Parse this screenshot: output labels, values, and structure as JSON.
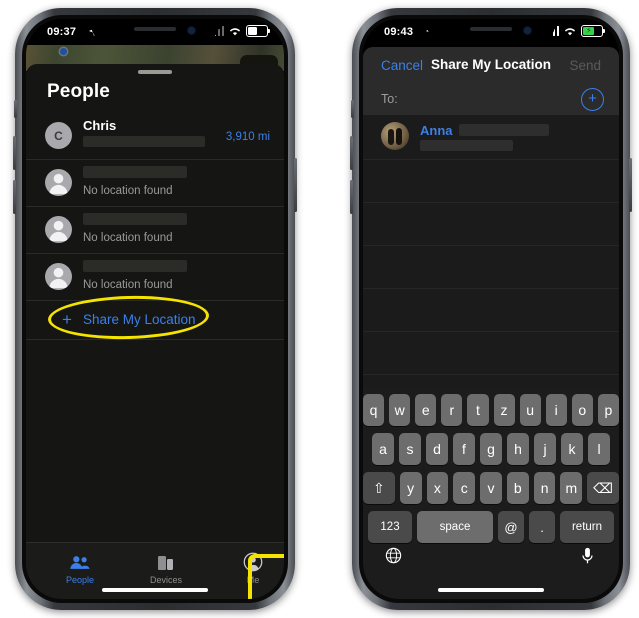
{
  "left_phone": {
    "status_bar": {
      "time": "09:37",
      "location_arrow_icon": "location-arrow-icon",
      "cellular_icon": "cellular-bars-icon",
      "wifi_icon": "wifi-icon",
      "battery_icon": "battery-icon",
      "battery_state": "normal"
    },
    "sheet_title": "People",
    "people": [
      {
        "avatar_initial": "C",
        "avatar_type": "initial",
        "name": "Chris",
        "subtitle": "",
        "distance": "3,910 mi",
        "redacted_address": true
      },
      {
        "avatar_initial": "",
        "avatar_type": "placeholder",
        "name": "",
        "subtitle": "No location found",
        "distance": "",
        "redacted_name": true
      },
      {
        "avatar_initial": "",
        "avatar_type": "placeholder",
        "name": "",
        "subtitle": "No location found",
        "distance": "",
        "redacted_name": true
      },
      {
        "avatar_initial": "",
        "avatar_type": "placeholder",
        "name": "",
        "subtitle": "No location found",
        "distance": "",
        "redacted_name": true
      }
    ],
    "share_row": {
      "plus": "+",
      "label": "Share My Location"
    },
    "tab_bar": [
      {
        "label": "People",
        "icon": "people-icon",
        "selected": true
      },
      {
        "label": "Devices",
        "icon": "devices-icon",
        "selected": false
      },
      {
        "label": "Me",
        "icon": "person-circle-icon",
        "selected": false
      }
    ],
    "highlights": {
      "share_ellipse": "yellow-ellipse-annotation",
      "me_box": "yellow-box-annotation"
    }
  },
  "right_phone": {
    "status_bar": {
      "time": "09:43",
      "location_arrow_icon": "location-arrow-icon",
      "cellular_icon": "cellular-bars-icon",
      "wifi_icon": "wifi-icon",
      "battery_icon": "battery-icon",
      "battery_state": "charging"
    },
    "nav": {
      "cancel": "Cancel",
      "title": "Share My Location",
      "send": "Send"
    },
    "to_field": {
      "label": "To:",
      "add_contact_icon": "plus-circle-icon",
      "add_symbol": "+"
    },
    "recipients": [
      {
        "name": "Anna",
        "avatar_type": "photo",
        "redacted": true
      }
    ],
    "keyboard": {
      "row1": [
        "q",
        "w",
        "e",
        "r",
        "t",
        "z",
        "u",
        "i",
        "o",
        "p"
      ],
      "row2": [
        "a",
        "s",
        "d",
        "f",
        "g",
        "h",
        "j",
        "k",
        "l"
      ],
      "row3_shift": "⇧",
      "row3": [
        "y",
        "x",
        "c",
        "v",
        "b",
        "n",
        "m"
      ],
      "row3_backspace": "⌫",
      "row4": {
        "numbers": "123",
        "at": "@",
        "space": "space",
        "period": ".",
        "return": "return"
      },
      "globe_icon": "globe-icon",
      "mic_icon": "microphone-icon"
    }
  },
  "accents": {
    "ios_blue": "#3c7fe8",
    "highlight_yellow": "#f5e300",
    "charging_green": "#36d14a",
    "secondary_gray": "#9a9a95"
  }
}
